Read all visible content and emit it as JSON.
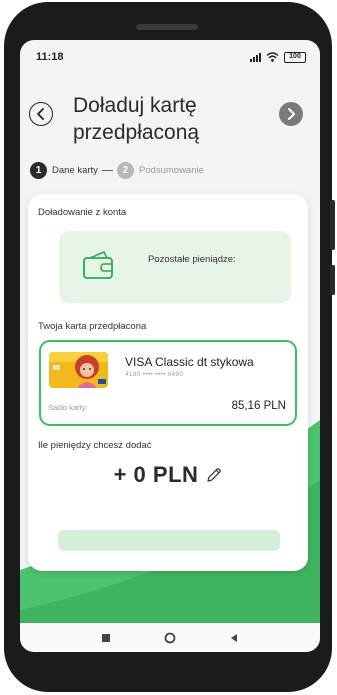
{
  "status_bar": {
    "time": "11:18",
    "battery": "100"
  },
  "header": {
    "title_line1": "Doładuj kartę",
    "title_line2": "przedpłaconą"
  },
  "stepper": {
    "steps": [
      {
        "number": "1",
        "label": "Dane karty",
        "state": "active"
      },
      {
        "number": "2",
        "label": "Podsumowanie",
        "state": "inactive"
      }
    ],
    "separator": "—"
  },
  "form": {
    "from_account_label": "Doładowanie z konta",
    "account_box": {
      "icon": "wallet-icon",
      "label": "Pozostałe pieniądze:"
    },
    "prepaid_label": "Twoja karta przedpłacona",
    "card": {
      "name": "VISA Classic dt stykowa",
      "number": "4180 •••• •••• 0490",
      "balance_label": "Saldo karty:",
      "balance_value": "85,16 PLN"
    },
    "amount_question": "Ile pieniędzy chcesz dodać",
    "amount_display": "+ 0 PLN"
  },
  "colors": {
    "accent_green": "#3cbf61",
    "light_green": "#e6f5e7",
    "button_green": "#d5f0d8",
    "background_green": "#4cc36c"
  },
  "nav_bar": {
    "icons": [
      "recent-apps-icon",
      "home-icon",
      "back-icon"
    ]
  }
}
